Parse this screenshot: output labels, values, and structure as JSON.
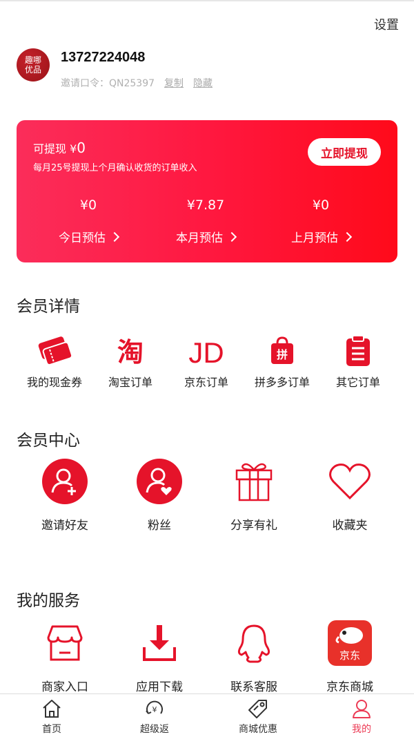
{
  "header": {
    "settings_label": "设置"
  },
  "profile": {
    "avatar_text_line1": "趣哪",
    "avatar_text_line2": "优品",
    "phone": "13727224048",
    "invite_label": "邀请口令：QN25397",
    "copy_label": "复制",
    "hide_label": "隐藏"
  },
  "earnings": {
    "withdrawable_label": "可提现 ¥",
    "withdrawable_value": "0",
    "subtitle": "每月25号提现上个月确认收货的订单收入",
    "withdraw_button": "立即提现",
    "stats": [
      {
        "value": "¥0",
        "label": "今日预估"
      },
      {
        "value": "¥7.87",
        "label": "本月预估"
      },
      {
        "value": "¥0",
        "label": "上月预估"
      }
    ]
  },
  "member_details": {
    "title": "会员详情",
    "items": [
      {
        "label": "我的现金券",
        "icon": "coupon-icon"
      },
      {
        "label": "淘宝订单",
        "icon": "taobao-icon"
      },
      {
        "label": "京东订单",
        "icon": "jd-icon"
      },
      {
        "label": "拼多多订单",
        "icon": "pinduoduo-icon"
      },
      {
        "label": "其它订单",
        "icon": "clipboard-icon"
      }
    ]
  },
  "member_center": {
    "title": "会员中心",
    "items": [
      {
        "label": "邀请好友",
        "icon": "invite-user-icon"
      },
      {
        "label": "粉丝",
        "icon": "fans-icon"
      },
      {
        "label": "分享有礼",
        "icon": "gift-icon"
      },
      {
        "label": "收藏夹",
        "icon": "heart-icon"
      }
    ]
  },
  "services": {
    "title": "我的服务",
    "items": [
      {
        "label": "商家入口",
        "icon": "store-icon"
      },
      {
        "label": "应用下载",
        "icon": "download-icon"
      },
      {
        "label": "联系客服",
        "icon": "qq-icon"
      },
      {
        "label": "京东商城",
        "icon": "jd-mall-icon",
        "icon_text": "京东"
      }
    ]
  },
  "tabbar": {
    "items": [
      {
        "label": "首页",
        "icon": "home-icon"
      },
      {
        "label": "超级返",
        "icon": "rebate-icon"
      },
      {
        "label": "商城优惠",
        "icon": "tag-icon"
      },
      {
        "label": "我的",
        "icon": "user-icon",
        "active": true
      }
    ]
  },
  "colors": {
    "brand_red": "#e5132a",
    "active_tab": "#ec3b55"
  }
}
